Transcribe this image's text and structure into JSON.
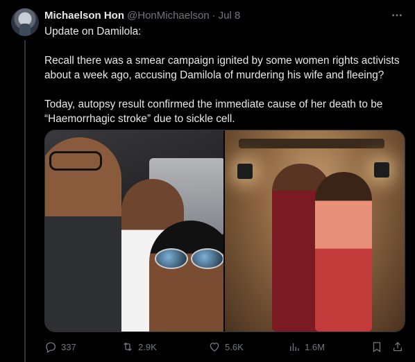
{
  "tweet": {
    "author_name": "Michaelson Hon",
    "author_handle": "@HonMichaelson",
    "separator": "·",
    "date": "Jul 8",
    "paragraphs": [
      "Update on Damilola:",
      "Recall there was a smear campaign ignited by some women rights activists about a week ago, accusing Damilola of murdering his wife and fleeing?",
      "Today, autopsy result confirmed the immediate cause of her death to be “Haemorrhagic stroke” due to sickle cell."
    ]
  },
  "actions": {
    "replies": "337",
    "reposts": "2.9K",
    "likes": "5.6K",
    "views": "1.6M"
  },
  "icons": {
    "avatar": "avatar-photo",
    "more": "more-horizontal-icon",
    "reply": "reply-icon",
    "repost": "repost-icon",
    "like": "heart-icon",
    "views": "views-icon",
    "bookmark": "bookmark-icon",
    "share": "share-icon"
  },
  "colors": {
    "background": "#000000",
    "text": "#e7e9ea",
    "muted": "#71767b",
    "border": "#2f3336"
  }
}
